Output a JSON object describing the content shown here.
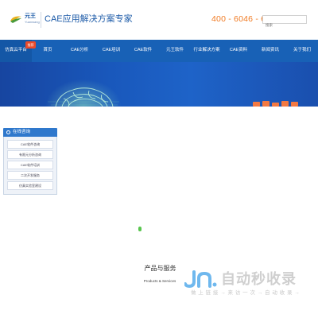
{
  "header": {
    "logo_name": "元王",
    "logo_sub": "Yuanwang",
    "slogan": "CAE应用解决方案专家",
    "phone": "400 - 6046 - 636",
    "search_placeholder": "搜索"
  },
  "nav": {
    "badge": "推荐",
    "items": [
      {
        "label": "仿真云平台"
      },
      {
        "label": "首页"
      },
      {
        "label": "CAE分析"
      },
      {
        "label": "CAE培训"
      },
      {
        "label": "CAE软件"
      },
      {
        "label": "元王软件"
      },
      {
        "label": "行业解决方案"
      },
      {
        "label": "CAE资料"
      },
      {
        "label": "新闻资讯"
      },
      {
        "label": "关于我们"
      }
    ]
  },
  "float_panel": {
    "title": "在线咨询",
    "items": [
      {
        "label": "CAE软件咨询"
      },
      {
        "label": "有限元分析咨询"
      },
      {
        "label": "CAE软件培训"
      },
      {
        "label": "二次开发服务"
      },
      {
        "label": "仿真实验室建设"
      }
    ]
  },
  "section": {
    "title": "产品与服务",
    "subtitle": "Products & Services"
  },
  "watermark": {
    "text": "自动秒收录",
    "tagline": "做 上 链 接 → 来 访 一 次 → 自 动 收 录 →"
  },
  "colors": {
    "brand_blue": "#1861b6",
    "phone_orange": "#f07a22",
    "badge_red": "#ea4a2a",
    "dot_green": "#58c64e"
  }
}
